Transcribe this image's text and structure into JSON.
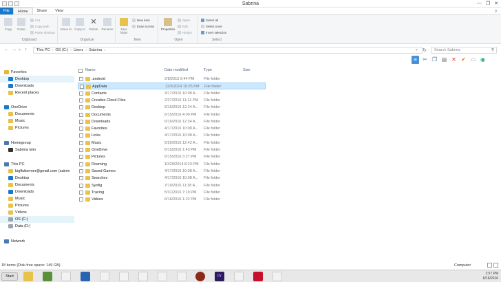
{
  "window": {
    "title": "Sabrina",
    "controls": [
      "—",
      "❐",
      "✕"
    ]
  },
  "ribbon": {
    "tabs": [
      "File",
      "Home",
      "Share",
      "View"
    ],
    "help": "?",
    "clipboard": {
      "copy": "Copy",
      "paste": "Paste",
      "cut": "Cut",
      "copy_path": "Copy path",
      "paste_shortcut": "Paste shortcut",
      "label": "Clipboard"
    },
    "organize": {
      "move_to": "Move to",
      "copy_to": "Copy to",
      "delete": "Delete",
      "rename": "Rename",
      "label": "Organize"
    },
    "new": {
      "new_folder": "New folder",
      "new_item": "New item",
      "easy_access": "Easy access",
      "label": "New"
    },
    "open": {
      "properties": "Properties",
      "open": "Open",
      "edit": "Edit",
      "history": "History",
      "label": "Open"
    },
    "select": {
      "select_all": "Select all",
      "select_none": "Select none",
      "invert": "Invert selection",
      "label": "Select"
    }
  },
  "address": {
    "back": "←",
    "forward": "→",
    "recent": "˅",
    "up": "↑",
    "crumbs": [
      "This PC",
      "OS (C:)",
      "Users",
      "Sabrina"
    ],
    "dropdown": "˅",
    "refresh": "↻",
    "search_placeholder": "Search Sabrina",
    "search_icon": "⚲"
  },
  "toolbar_icons": [
    "≡",
    "✂",
    "❐",
    "▤",
    "✕",
    "✔",
    "▭",
    "◉"
  ],
  "nav": {
    "favorites": "Favorites",
    "favorites_items": [
      "Desktop",
      "Downloads",
      "Recent places"
    ],
    "onedrive": "OneDrive",
    "onedrive_items": [
      "Documents",
      "Music",
      "Pictures"
    ],
    "homegroup": "Homegroup",
    "homegroup_items": [
      "Sabrina lwin"
    ],
    "thispc": "This PC",
    "thispc_items": [
      "bigfluttermer@gmail.com (sabrin",
      "Desktop",
      "Documents",
      "Downloads",
      "Music",
      "Pictures",
      "Videos",
      "OS (C:)",
      "Data (D:)"
    ],
    "network": "Network"
  },
  "columns": {
    "name": "Name",
    "date": "Date modified",
    "type": "Type",
    "size": "Size"
  },
  "files": [
    {
      "name": ".android",
      "date": "2/8/2015 9:44 PM",
      "type": "File folder"
    },
    {
      "name": "AppData",
      "date": "12/3/2014 10:25 PM",
      "type": "File folder"
    },
    {
      "name": "Contacts",
      "date": "4/17/2016 10:08 A...",
      "type": "File folder"
    },
    {
      "name": "Creative Cloud Files",
      "date": "2/27/2016 11:13 PM",
      "type": "File folder"
    },
    {
      "name": "Desktop",
      "date": "6/16/2016 12:24 A...",
      "type": "File folder"
    },
    {
      "name": "Documents",
      "date": "6/15/2016 4:09 PM",
      "type": "File folder"
    },
    {
      "name": "Downloads",
      "date": "6/16/2016 12:34 A...",
      "type": "File folder"
    },
    {
      "name": "Favorites",
      "date": "4/17/2016 10:08 A...",
      "type": "File folder"
    },
    {
      "name": "Links",
      "date": "4/17/2016 10:08 A...",
      "type": "File folder"
    },
    {
      "name": "Music",
      "date": "5/29/2016 12:42 A...",
      "type": "File folder"
    },
    {
      "name": "OneDrive",
      "date": "6/15/2016 1:43 PM",
      "type": "File folder"
    },
    {
      "name": "Pictures",
      "date": "6/15/2016 3:27 PM",
      "type": "File folder"
    },
    {
      "name": "Roaming",
      "date": "10/29/2014 8:23 PM",
      "type": "File folder"
    },
    {
      "name": "Saved Games",
      "date": "4/17/2016 10:08 A...",
      "type": "File folder"
    },
    {
      "name": "Searches",
      "date": "4/17/2016 10:08 A...",
      "type": "File folder"
    },
    {
      "name": "Synfig",
      "date": "7/19/2015 11:38 A...",
      "type": "File folder"
    },
    {
      "name": "Tracing",
      "date": "5/31/2016 7:19 PM",
      "type": "File folder"
    },
    {
      "name": "Videos",
      "date": "6/16/2016 1:22 PM",
      "type": "File folder"
    }
  ],
  "status": {
    "text": "18 items (Disk free space: 149 GB)",
    "computer": "Computer"
  },
  "taskbar": {
    "start": "Start",
    "pr_label": "Pr",
    "clock_time": "1:57 PM",
    "clock_date": "6/16/2016"
  }
}
